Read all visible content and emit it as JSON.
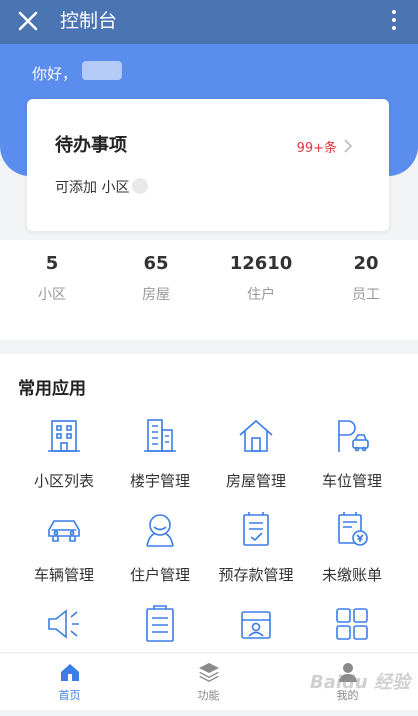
{
  "header": {
    "title": "控制台"
  },
  "greeting": "你好，",
  "todo": {
    "title": "待办事项",
    "count": "99+条",
    "subtitle": "可添加 小区"
  },
  "stats": [
    {
      "value": "5",
      "label": "小区"
    },
    {
      "value": "65",
      "label": "房屋"
    },
    {
      "value": "12610",
      "label": "住户"
    },
    {
      "value": "20",
      "label": "员工"
    }
  ],
  "apps": {
    "title": "常用应用",
    "items": [
      {
        "label": "小区列表",
        "icon": "building-icon"
      },
      {
        "label": "楼宇管理",
        "icon": "tower-icon"
      },
      {
        "label": "房屋管理",
        "icon": "house-icon"
      },
      {
        "label": "车位管理",
        "icon": "parking-icon"
      },
      {
        "label": "车辆管理",
        "icon": "car-icon"
      },
      {
        "label": "住户管理",
        "icon": "resident-icon"
      },
      {
        "label": "预存款管理",
        "icon": "deposit-icon"
      },
      {
        "label": "未缴账单",
        "icon": "bill-icon"
      },
      {
        "label": "",
        "icon": "megaphone-icon"
      },
      {
        "label": "",
        "icon": "clipboard-icon"
      },
      {
        "label": "",
        "icon": "id-card-icon"
      },
      {
        "label": "",
        "icon": "grid-icon"
      }
    ]
  },
  "tabbar": [
    {
      "label": "首页",
      "icon": "home-icon",
      "active": true
    },
    {
      "label": "功能",
      "icon": "layers-icon",
      "active": false
    },
    {
      "label": "我的",
      "icon": "user-icon",
      "active": false
    }
  ],
  "watermark": "Baidu 经验",
  "colors": {
    "header": "#4a74b2",
    "hero": "#5a8ded",
    "icon": "#3b7de8",
    "count": "#e2393e"
  }
}
